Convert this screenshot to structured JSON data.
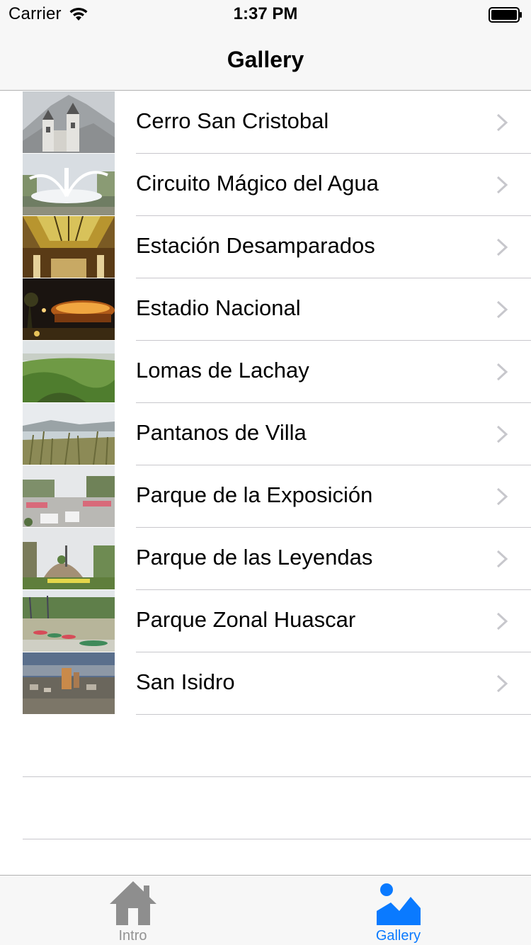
{
  "status_bar": {
    "carrier": "Carrier",
    "time": "1:37 PM"
  },
  "nav": {
    "title": "Gallery"
  },
  "gallery": {
    "items": [
      {
        "label": "Cerro San Cristobal",
        "thumbnail": "church-hill-photo"
      },
      {
        "label": "Circuito Mágico del Agua",
        "thumbnail": "fountain-photo"
      },
      {
        "label": "Estación Desamparados",
        "thumbnail": "stained-glass-ceiling-photo"
      },
      {
        "label": "Estadio Nacional",
        "thumbnail": "stadium-night-photo"
      },
      {
        "label": "Lomas de Lachay",
        "thumbnail": "green-hills-photo"
      },
      {
        "label": "Pantanos de Villa",
        "thumbnail": "wetlands-photo"
      },
      {
        "label": "Parque de la Exposición",
        "thumbnail": "park-plaza-photo"
      },
      {
        "label": "Parque de las Leyendas",
        "thumbnail": "park-garden-photo"
      },
      {
        "label": "Parque Zonal Huascar",
        "thumbnail": "lake-boats-photo"
      },
      {
        "label": "San Isidro",
        "thumbnail": "city-skyline-photo"
      }
    ]
  },
  "tab_bar": {
    "tabs": [
      {
        "label": "Intro",
        "icon": "home-icon",
        "selected": false
      },
      {
        "label": "Gallery",
        "icon": "image-icon",
        "selected": true
      }
    ]
  },
  "colors": {
    "accent": "#0a7aff",
    "inactive_tab": "#929292",
    "separator": "#c8c7cc",
    "bar_background": "#f7f7f7"
  }
}
